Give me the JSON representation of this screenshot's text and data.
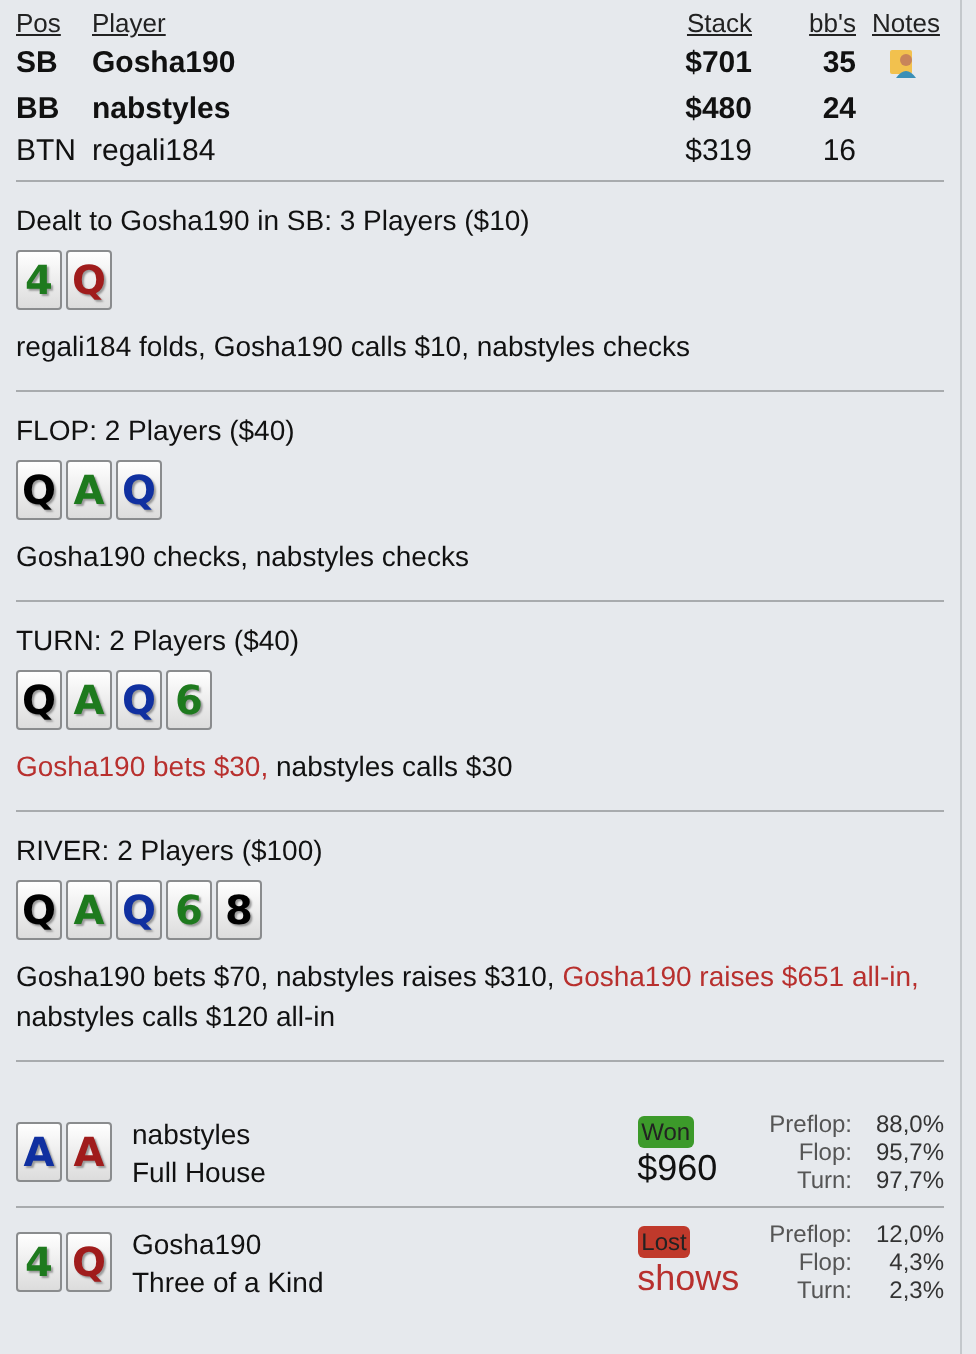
{
  "players": {
    "columns": [
      "Pos",
      "Player",
      "Stack",
      "bb's",
      "Notes"
    ],
    "rows": [
      {
        "pos": "SB",
        "player": "Gosha190",
        "stack": "$701",
        "bbs": "35",
        "bold": true,
        "has_notes": true
      },
      {
        "pos": "BB",
        "player": "nabstyles",
        "stack": "$480",
        "bbs": "24",
        "bold": true,
        "has_notes": false
      },
      {
        "pos": "BTN",
        "player": "regali184",
        "stack": "$319",
        "bbs": "16",
        "bold": false,
        "has_notes": false
      }
    ]
  },
  "streets": [
    {
      "title": "Dealt to Gosha190 in SB: 3 Players ($10)",
      "cards": [
        {
          "rank": "4",
          "color": "#1e7a1e"
        },
        {
          "rank": "Q",
          "color": "#a01c1c"
        }
      ],
      "actions": [
        {
          "text": "regali184 folds, Gosha190 calls $10, nabstyles checks",
          "highlighted": false
        }
      ]
    },
    {
      "title": "FLOP: 2 Players ($40)",
      "cards": [
        {
          "rank": "Q",
          "color": "#000000"
        },
        {
          "rank": "A",
          "color": "#1e7a1e"
        },
        {
          "rank": "Q",
          "color": "#1030a0"
        }
      ],
      "actions": [
        {
          "text": "Gosha190 checks, nabstyles checks",
          "highlighted": false
        }
      ]
    },
    {
      "title": "TURN: 2 Players ($40)",
      "cards": [
        {
          "rank": "Q",
          "color": "#000000"
        },
        {
          "rank": "A",
          "color": "#1e7a1e"
        },
        {
          "rank": "Q",
          "color": "#1030a0"
        },
        {
          "rank": "6",
          "color": "#1e7a1e"
        }
      ],
      "actions": [
        {
          "text": "Gosha190 bets $30,",
          "highlighted": true
        },
        {
          "text": " nabstyles calls $30",
          "highlighted": false
        }
      ]
    },
    {
      "title": "RIVER: 2 Players ($100)",
      "cards": [
        {
          "rank": "Q",
          "color": "#000000"
        },
        {
          "rank": "A",
          "color": "#1e7a1e"
        },
        {
          "rank": "Q",
          "color": "#1030a0"
        },
        {
          "rank": "6",
          "color": "#1e7a1e"
        },
        {
          "rank": "8",
          "color": "#000000"
        }
      ],
      "actions": [
        {
          "text": "Gosha190 bets $70, nabstyles raises $310, ",
          "highlighted": false
        },
        {
          "text": "Gosha190 raises $651 all-in,",
          "highlighted": true
        },
        {
          "text": " nabstyles calls $120 all-in",
          "highlighted": false
        }
      ]
    }
  ],
  "results": [
    {
      "cards": [
        {
          "rank": "A",
          "color": "#1030a0"
        },
        {
          "rank": "A",
          "color": "#a01c1c"
        }
      ],
      "player": "nabstyles",
      "hand": "Full House",
      "won": true,
      "badge": "Won",
      "amount": "$960",
      "equity": [
        {
          "label": "Preflop:",
          "value": "88,0%"
        },
        {
          "label": "Flop:",
          "value": "95,7%"
        },
        {
          "label": "Turn:",
          "value": "97,7%"
        }
      ]
    },
    {
      "cards": [
        {
          "rank": "4",
          "color": "#1e7a1e"
        },
        {
          "rank": "Q",
          "color": "#a01c1c"
        }
      ],
      "player": "Gosha190",
      "hand": "Three of a Kind",
      "won": false,
      "badge": "Lost",
      "amount": "shows",
      "equity": [
        {
          "label": "Preflop:",
          "value": "12,0%"
        },
        {
          "label": "Flop:",
          "value": "4,3%"
        },
        {
          "label": "Turn:",
          "value": "2,3%"
        }
      ]
    }
  ]
}
